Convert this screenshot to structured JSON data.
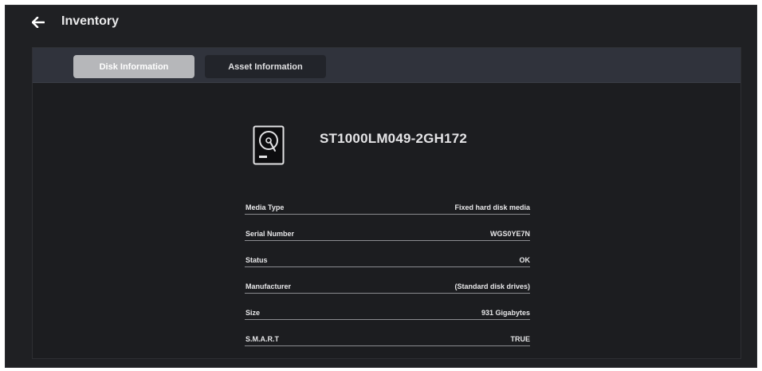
{
  "header": {
    "title": "Inventory",
    "back_icon": "arrow-left-icon"
  },
  "tabs": [
    {
      "label": "Disk Information",
      "active": true
    },
    {
      "label": "Asset Information",
      "active": false
    }
  ],
  "disk": {
    "icon": "hard-disk-icon",
    "model": "ST1000LM049-2GH172",
    "rows": [
      {
        "label": "Media Type",
        "value": "Fixed hard disk media"
      },
      {
        "label": "Serial Number",
        "value": "WGS0YE7N"
      },
      {
        "label": "Status",
        "value": "OK"
      },
      {
        "label": "Manufacturer",
        "value": "(Standard disk drives)"
      },
      {
        "label": "Size",
        "value": "931 Gigabytes"
      },
      {
        "label": "S.M.A.R.T",
        "value": "TRUE"
      }
    ]
  },
  "colors": {
    "background": "#1f2023",
    "tabbar": "#30333c",
    "active_tab": "#b6b7ba",
    "inactive_tab": "#22242a",
    "text": "#e7e7e9"
  }
}
